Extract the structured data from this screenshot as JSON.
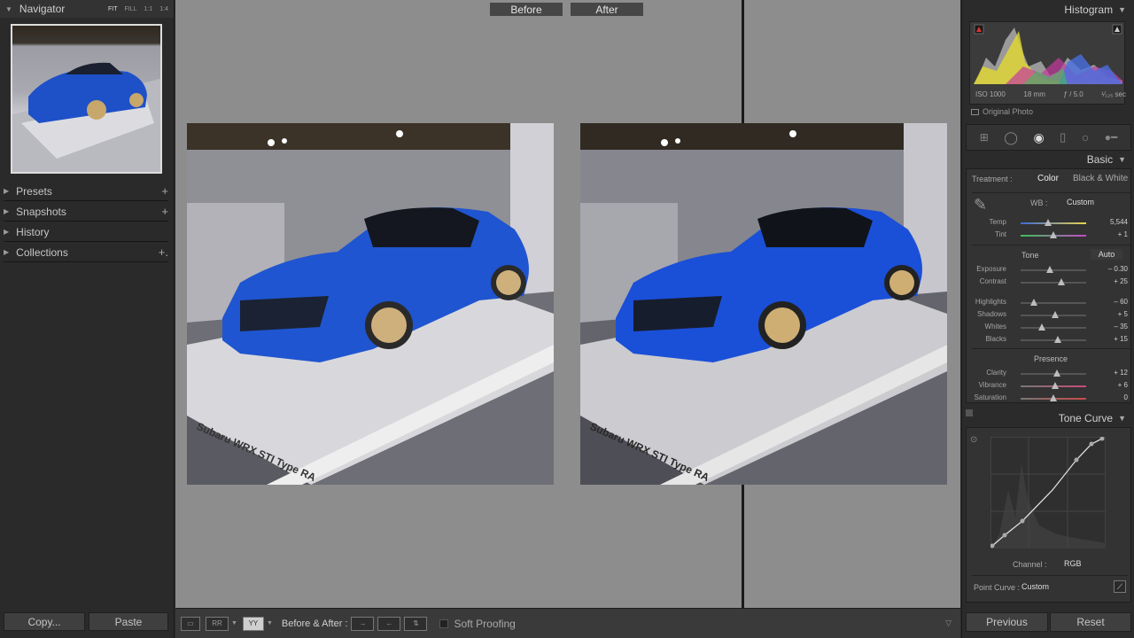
{
  "left": {
    "navigator": {
      "title": "Navigator",
      "zoom": [
        "FIT",
        "FILL",
        "1:1",
        "1:4"
      ]
    },
    "sections": [
      {
        "label": "Presets",
        "action": "+"
      },
      {
        "label": "Snapshots",
        "action": "+"
      },
      {
        "label": "History",
        "action": ""
      },
      {
        "label": "Collections",
        "action": "+."
      }
    ],
    "copy_label": "Copy...",
    "paste_label": "Paste"
  },
  "center": {
    "before_label": "Before",
    "after_label": "After",
    "placard_text": "Subaru WRX STI Type RA"
  },
  "toolbar": {
    "view_icons": [
      "loupe-view",
      "before-after-lr",
      "before-after-split"
    ],
    "ba_label": "Before & After :",
    "soft_proofing_label": "Soft Proofing"
  },
  "right": {
    "histogram": {
      "title": "Histogram",
      "iso": "ISO 1000",
      "focal": "18 mm",
      "aperture": "ƒ / 5.0",
      "shutter": "¹⁄₁₂₅ sec",
      "original_photo_label": "Original Photo"
    },
    "basic": {
      "title": "Basic",
      "treatment_label": "Treatment :",
      "treatment_color": "Color",
      "treatment_bw": "Black & White",
      "wb_label": "WB :",
      "wb_value": "Custom",
      "tone_label": "Tone",
      "auto_label": "Auto",
      "presence_label": "Presence",
      "sliders": [
        {
          "label": "Temp",
          "value": "5,544",
          "pos": 0.42
        },
        {
          "label": "Tint",
          "value": "+ 1",
          "pos": 0.5
        },
        {
          "label": "Exposure",
          "value": "– 0.30",
          "pos": 0.45
        },
        {
          "label": "Contrast",
          "value": "+ 25",
          "pos": 0.62
        },
        {
          "label": "Highlights",
          "value": "– 60",
          "pos": 0.2
        },
        {
          "label": "Shadows",
          "value": "+ 5",
          "pos": 0.53
        },
        {
          "label": "Whites",
          "value": "– 35",
          "pos": 0.33
        },
        {
          "label": "Blacks",
          "value": "+ 15",
          "pos": 0.57
        },
        {
          "label": "Clarity",
          "value": "+ 12",
          "pos": 0.56
        },
        {
          "label": "Vibrance",
          "value": "+ 6",
          "pos": 0.53
        },
        {
          "label": "Saturation",
          "value": "0",
          "pos": 0.5
        }
      ]
    },
    "tone_curve": {
      "title": "Tone Curve",
      "channel_label": "Channel :",
      "channel_value": "RGB",
      "point_curve_label": "Point Curve :",
      "point_curve_value": "Custom"
    },
    "previous_label": "Previous",
    "reset_label": "Reset"
  }
}
